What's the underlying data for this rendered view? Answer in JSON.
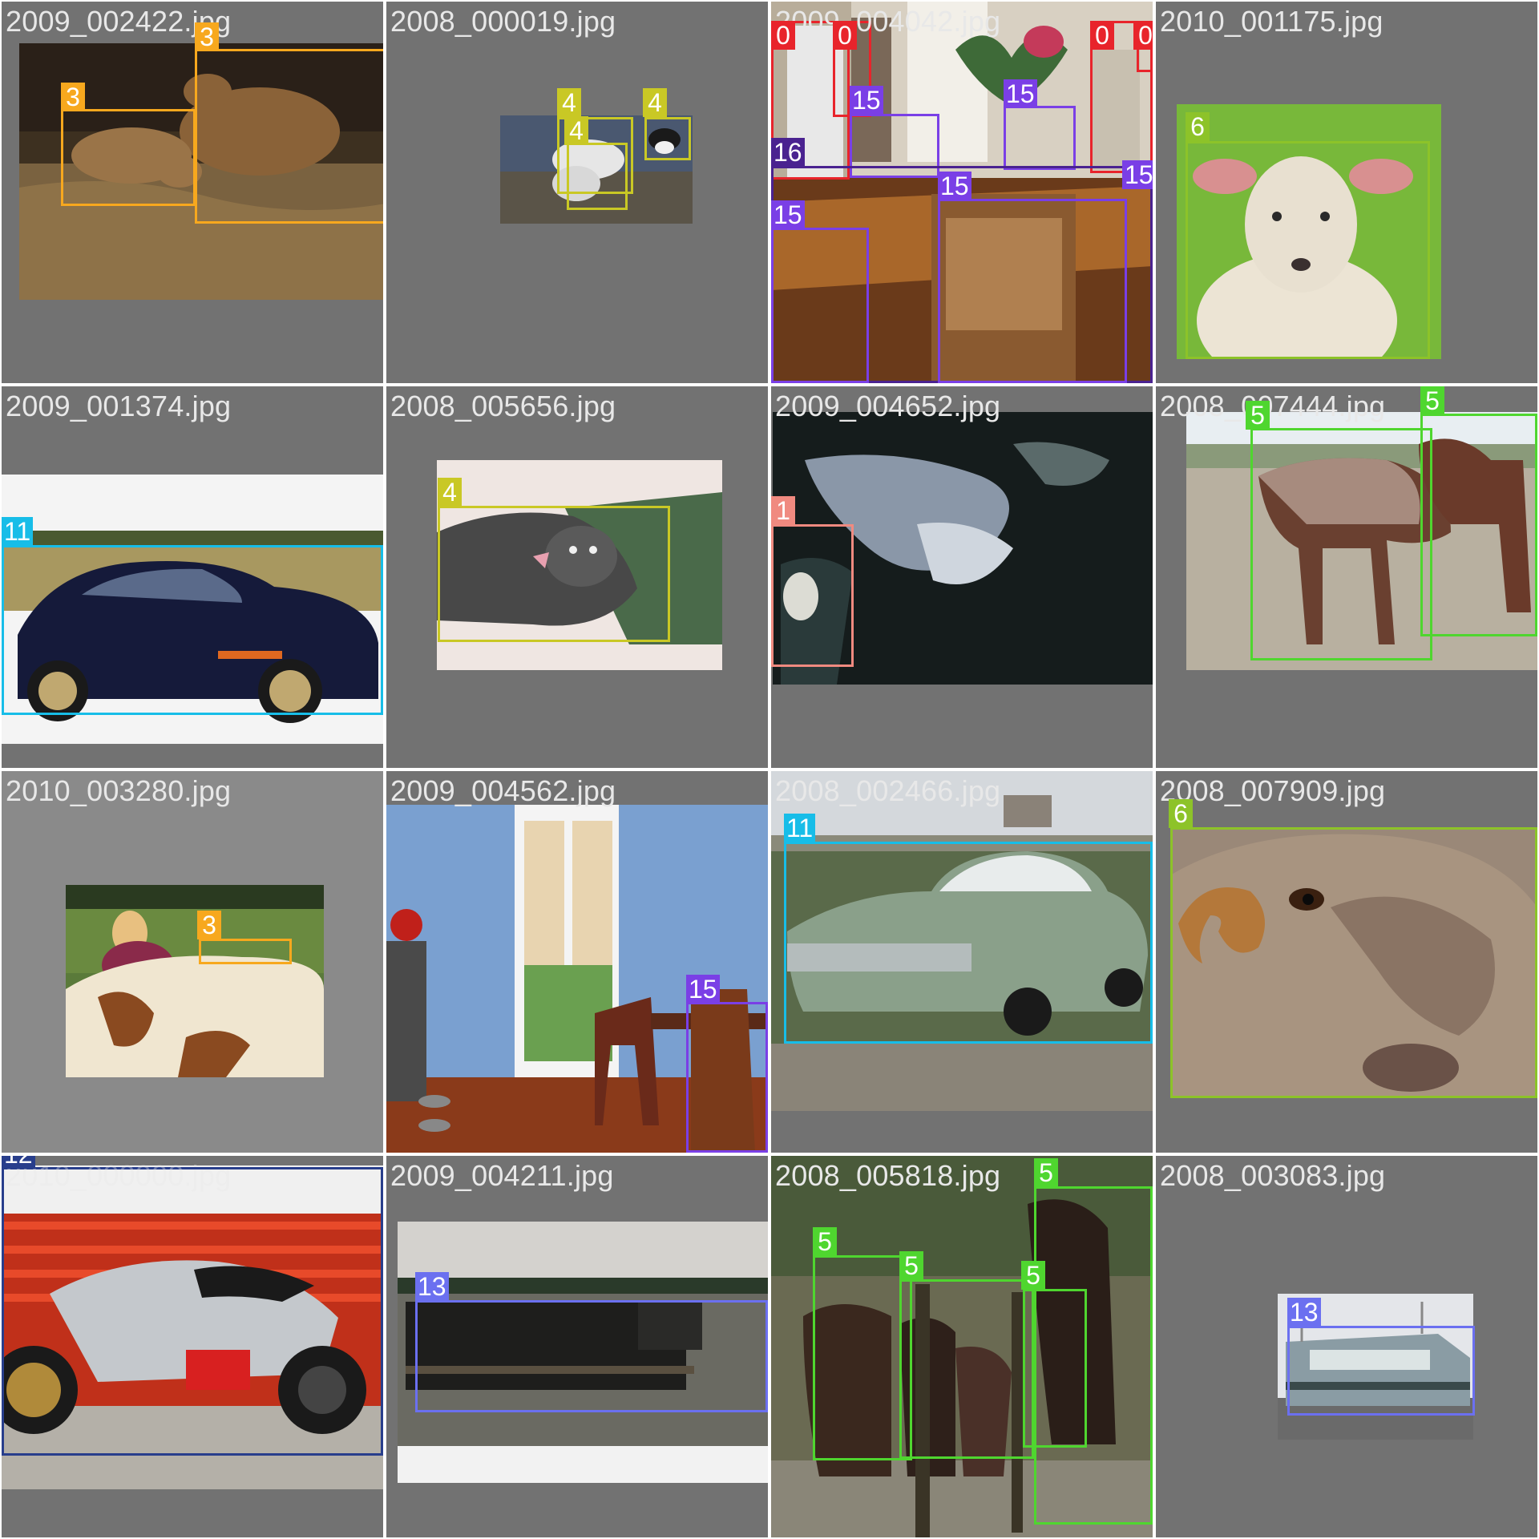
{
  "grid_title": "",
  "class_colors": {
    "0": "#e8242b",
    "1": "#f08a80",
    "3": "#f7a81e",
    "4": "#c9c825",
    "5": "#4fd62f",
    "6": "#8dc329",
    "11": "#17bde8",
    "12": "#283e8c",
    "13": "#6b70f0",
    "15": "#7a3fe6",
    "16": "#4a2290"
  },
  "tiles": [
    {
      "filename": "2009_002422.jpg",
      "scene": "cows in barn on straw",
      "labels": [
        "3",
        "3"
      ]
    },
    {
      "filename": "2008_000019.jpg",
      "scene": "dogs lying on ground",
      "labels": [
        "4",
        "4",
        "4"
      ]
    },
    {
      "filename": "2009_004042.jpg",
      "scene": "dining room with people, chairs and table",
      "labels": [
        "0",
        "0",
        "0",
        "0",
        "15",
        "15",
        "16",
        "15",
        "15",
        "15"
      ]
    },
    {
      "filename": "2010_001175.jpg",
      "scene": "sheep face on green background",
      "labels": [
        "6"
      ]
    },
    {
      "filename": "2009_001374.jpg",
      "scene": "dark blue sports car",
      "labels": [
        "11"
      ]
    },
    {
      "filename": "2008_005656.jpg",
      "scene": "speckled dog on green cushion",
      "labels": [
        "4"
      ]
    },
    {
      "filename": "2009_004652.jpg",
      "scene": "heron at pond reflection",
      "labels": [
        "1"
      ]
    },
    {
      "filename": "2008_007444.jpg",
      "scene": "two horses in field",
      "labels": [
        "5",
        "5"
      ]
    },
    {
      "filename": "2010_003280.jpg",
      "scene": "woman with pinto horse",
      "labels": [
        "3"
      ]
    },
    {
      "filename": "2009_004562.jpg",
      "scene": "kitchen with glass door and chairs",
      "labels": [
        "15"
      ]
    },
    {
      "filename": "2008_002466.jpg",
      "scene": "classic green car on grass",
      "labels": [
        "11"
      ]
    },
    {
      "filename": "2008_007909.jpg",
      "scene": "ram close-up with curled horn",
      "labels": [
        "6"
      ]
    },
    {
      "filename": "2010_000000.jpg",
      "scene": "silver motorcycle by red wall",
      "labels": [
        "12"
      ]
    },
    {
      "filename": "2009_004211.jpg",
      "scene": "dark locomotive",
      "labels": [
        "13"
      ]
    },
    {
      "filename": "2008_005818.jpg",
      "scene": "horses under trees",
      "labels": [
        "5",
        "5",
        "5",
        "5"
      ]
    },
    {
      "filename": "2008_003083.jpg",
      "scene": "electric train at platform",
      "labels": [
        "13"
      ]
    }
  ]
}
